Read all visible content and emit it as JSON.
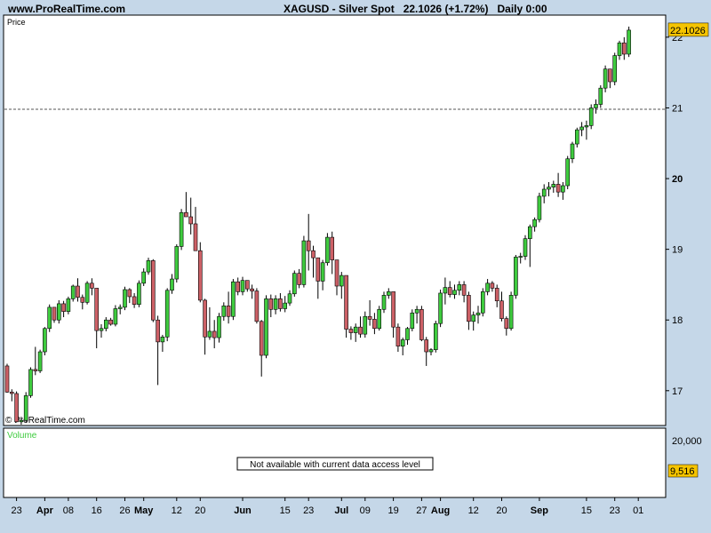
{
  "header": {
    "site": "www.ProRealTime.com",
    "symbol": "XAGUSD - Silver Spot",
    "last": "22.1026",
    "change": "(+1.72%)",
    "timeframe": "Daily",
    "time": "0:00"
  },
  "price_panel": {
    "label": "Price",
    "watermark": "© ProRealTime.com",
    "last_price_tag": "22.1026",
    "reference_line": 20.98
  },
  "volume_panel": {
    "label": "Volume",
    "message": "Not available with current data access level",
    "axis_label": "20,000",
    "value_tag": "9,516"
  },
  "colors": {
    "up": "#3ecb3e",
    "down": "#cc6066",
    "panel_bg": "#ffffff",
    "frame_bg": "#c5d7e8",
    "tag": "#f5c400",
    "volume_label": "#3ecb3e"
  },
  "chart_data": {
    "type": "candlestick",
    "title": "XAGUSD - Silver Spot",
    "ylim": [
      16.52,
      22.3
    ],
    "y_ticks": [
      17,
      18,
      19,
      20,
      21,
      22
    ],
    "x_tick_labels": [
      {
        "label": "23",
        "bar": 2,
        "bold": false
      },
      {
        "label": "Apr",
        "bar": 8,
        "bold": true
      },
      {
        "label": "08",
        "bar": 13,
        "bold": false
      },
      {
        "label": "16",
        "bar": 19,
        "bold": false
      },
      {
        "label": "26",
        "bar": 25,
        "bold": false
      },
      {
        "label": "May",
        "bar": 29,
        "bold": true
      },
      {
        "label": "12",
        "bar": 36,
        "bold": false
      },
      {
        "label": "20",
        "bar": 41,
        "bold": false
      },
      {
        "label": "Jun",
        "bar": 50,
        "bold": true
      },
      {
        "label": "15",
        "bar": 59,
        "bold": false
      },
      {
        "label": "23",
        "bar": 64,
        "bold": false
      },
      {
        "label": "Jul",
        "bar": 71,
        "bold": true
      },
      {
        "label": "09",
        "bar": 76,
        "bold": false
      },
      {
        "label": "19",
        "bar": 82,
        "bold": false
      },
      {
        "label": "27",
        "bar": 88,
        "bold": false
      },
      {
        "label": "Aug",
        "bar": 92,
        "bold": true
      },
      {
        "label": "12",
        "bar": 99,
        "bold": false
      },
      {
        "label": "20",
        "bar": 105,
        "bold": false
      },
      {
        "label": "Sep",
        "bar": 113,
        "bold": true
      },
      {
        "label": "15",
        "bar": 123,
        "bold": false
      },
      {
        "label": "23",
        "bar": 129,
        "bold": false
      },
      {
        "label": "01",
        "bar": 134,
        "bold": false
      }
    ],
    "candles": [
      [
        17.35,
        17.38,
        16.97,
        16.98
      ],
      [
        16.98,
        17.02,
        16.85,
        16.96
      ],
      [
        16.96,
        16.99,
        16.55,
        16.56
      ],
      [
        16.56,
        16.63,
        16.52,
        16.58
      ],
      [
        16.58,
        16.98,
        16.55,
        16.93
      ],
      [
        16.93,
        17.33,
        16.9,
        17.3
      ],
      [
        17.3,
        17.62,
        17.22,
        17.28
      ],
      [
        17.28,
        17.58,
        17.25,
        17.55
      ],
      [
        17.55,
        17.9,
        17.5,
        17.88
      ],
      [
        17.88,
        18.22,
        17.83,
        18.18
      ],
      [
        18.18,
        18.13,
        17.96,
        18.0
      ],
      [
        18.0,
        18.28,
        17.95,
        18.23
      ],
      [
        18.23,
        18.27,
        18.04,
        18.12
      ],
      [
        18.12,
        18.33,
        18.08,
        18.3
      ],
      [
        18.3,
        18.5,
        18.26,
        18.48
      ],
      [
        18.48,
        18.59,
        18.26,
        18.32
      ],
      [
        18.32,
        18.36,
        18.15,
        18.25
      ],
      [
        18.25,
        18.55,
        18.22,
        18.52
      ],
      [
        18.52,
        18.59,
        18.35,
        18.45
      ],
      [
        18.45,
        18.43,
        17.6,
        17.85
      ],
      [
        17.85,
        17.94,
        17.75,
        17.88
      ],
      [
        17.88,
        18.04,
        17.84,
        18.0
      ],
      [
        18.0,
        18.03,
        17.92,
        17.94
      ],
      [
        17.94,
        18.21,
        17.91,
        18.16
      ],
      [
        18.16,
        18.22,
        18.08,
        18.18
      ],
      [
        18.18,
        18.47,
        18.14,
        18.43
      ],
      [
        18.43,
        18.45,
        18.24,
        18.33
      ],
      [
        18.33,
        18.38,
        18.17,
        18.22
      ],
      [
        18.22,
        18.56,
        18.18,
        18.52
      ],
      [
        18.52,
        18.73,
        18.48,
        18.68
      ],
      [
        18.68,
        18.88,
        18.64,
        18.84
      ],
      [
        18.84,
        18.86,
        17.97,
        18.0
      ],
      [
        18.0,
        18.06,
        17.08,
        17.69
      ],
      [
        17.69,
        17.79,
        17.55,
        17.76
      ],
      [
        17.76,
        18.45,
        17.7,
        18.42
      ],
      [
        18.42,
        18.65,
        18.37,
        18.58
      ],
      [
        18.58,
        19.07,
        18.53,
        19.04
      ],
      [
        19.04,
        19.57,
        18.99,
        19.52
      ],
      [
        19.52,
        19.81,
        19.48,
        19.46
      ],
      [
        19.46,
        19.73,
        19.21,
        19.36
      ],
      [
        19.36,
        19.6,
        19.2,
        18.98
      ],
      [
        18.98,
        19.1,
        18.25,
        18.28
      ],
      [
        18.28,
        18.3,
        17.51,
        17.76
      ],
      [
        17.76,
        18.18,
        17.72,
        17.84
      ],
      [
        17.84,
        18.0,
        17.6,
        17.75
      ],
      [
        17.75,
        18.1,
        17.68,
        18.05
      ],
      [
        18.05,
        18.25,
        17.99,
        18.2
      ],
      [
        18.2,
        18.4,
        17.95,
        18.05
      ],
      [
        18.05,
        18.58,
        18.0,
        18.54
      ],
      [
        18.54,
        18.6,
        18.35,
        18.4
      ],
      [
        18.4,
        18.61,
        18.35,
        18.56
      ],
      [
        18.56,
        18.52,
        18.4,
        18.44
      ],
      [
        18.44,
        18.5,
        18.3,
        18.41
      ],
      [
        18.41,
        18.45,
        17.95,
        17.98
      ],
      [
        17.98,
        18.0,
        17.2,
        17.5
      ],
      [
        17.5,
        18.35,
        17.46,
        18.3
      ],
      [
        18.3,
        18.36,
        18.04,
        18.15
      ],
      [
        18.15,
        18.35,
        18.08,
        18.3
      ],
      [
        18.3,
        18.38,
        18.12,
        18.16
      ],
      [
        18.16,
        18.34,
        18.11,
        18.24
      ],
      [
        18.24,
        18.42,
        18.2,
        18.37
      ],
      [
        18.37,
        18.7,
        18.33,
        18.66
      ],
      [
        18.66,
        18.72,
        18.45,
        18.5
      ],
      [
        18.5,
        19.19,
        18.46,
        19.12
      ],
      [
        19.12,
        19.5,
        18.7,
        18.98
      ],
      [
        18.98,
        19.05,
        18.6,
        18.88
      ],
      [
        18.88,
        18.83,
        18.3,
        18.55
      ],
      [
        18.55,
        18.85,
        18.42,
        18.81
      ],
      [
        18.81,
        19.23,
        18.77,
        19.17
      ],
      [
        19.17,
        19.25,
        18.65,
        18.85
      ],
      [
        18.85,
        18.72,
        18.35,
        18.48
      ],
      [
        18.48,
        18.68,
        18.3,
        18.63
      ],
      [
        18.63,
        18.58,
        17.75,
        17.87
      ],
      [
        17.87,
        17.91,
        17.72,
        17.82
      ],
      [
        17.82,
        17.95,
        17.69,
        17.9
      ],
      [
        17.9,
        18.05,
        17.75,
        17.8
      ],
      [
        17.8,
        18.12,
        17.75,
        18.05
      ],
      [
        18.05,
        18.28,
        17.92,
        18.01
      ],
      [
        18.01,
        18.1,
        17.8,
        17.88
      ],
      [
        17.88,
        18.2,
        17.85,
        18.15
      ],
      [
        18.15,
        18.4,
        18.1,
        18.35
      ],
      [
        18.35,
        18.45,
        18.3,
        18.4
      ],
      [
        18.4,
        18.35,
        17.75,
        17.9
      ],
      [
        17.9,
        17.95,
        17.55,
        17.63
      ],
      [
        17.63,
        17.75,
        17.5,
        17.72
      ],
      [
        17.72,
        17.9,
        17.65,
        17.88
      ],
      [
        17.88,
        18.15,
        17.84,
        18.1
      ],
      [
        18.1,
        18.2,
        17.95,
        18.15
      ],
      [
        18.15,
        18.2,
        17.7,
        17.72
      ],
      [
        17.72,
        17.76,
        17.35,
        17.55
      ],
      [
        17.55,
        17.6,
        17.5,
        17.58
      ],
      [
        17.58,
        17.99,
        17.54,
        17.95
      ],
      [
        17.95,
        18.43,
        17.9,
        18.38
      ],
      [
        18.38,
        18.6,
        18.22,
        18.46
      ],
      [
        18.46,
        18.55,
        18.32,
        18.36
      ],
      [
        18.36,
        18.5,
        18.3,
        18.42
      ],
      [
        18.42,
        18.55,
        18.35,
        18.5
      ],
      [
        18.5,
        18.55,
        18.25,
        18.35
      ],
      [
        18.35,
        18.4,
        17.86,
        17.98
      ],
      [
        17.98,
        18.12,
        17.85,
        18.07
      ],
      [
        18.07,
        18.2,
        17.95,
        18.1
      ],
      [
        18.1,
        18.45,
        18.05,
        18.4
      ],
      [
        18.4,
        18.58,
        18.35,
        18.52
      ],
      [
        18.52,
        18.55,
        18.4,
        18.45
      ],
      [
        18.45,
        18.5,
        18.18,
        18.27
      ],
      [
        18.27,
        18.4,
        17.98,
        18.02
      ],
      [
        18.02,
        18.05,
        17.78,
        17.88
      ],
      [
        17.88,
        18.4,
        17.85,
        18.35
      ],
      [
        18.35,
        18.92,
        18.3,
        18.89
      ],
      [
        18.89,
        18.95,
        18.8,
        18.9
      ],
      [
        18.9,
        19.2,
        18.85,
        19.15
      ],
      [
        19.15,
        19.35,
        18.75,
        19.32
      ],
      [
        19.32,
        19.45,
        19.25,
        19.42
      ],
      [
        19.42,
        19.8,
        19.38,
        19.75
      ],
      [
        19.75,
        19.92,
        19.65,
        19.85
      ],
      [
        19.85,
        19.95,
        19.75,
        19.88
      ],
      [
        19.88,
        19.97,
        19.8,
        19.92
      ],
      [
        19.92,
        20.08,
        19.74,
        19.81
      ],
      [
        19.81,
        19.95,
        19.7,
        19.9
      ],
      [
        19.9,
        20.32,
        19.85,
        20.28
      ],
      [
        20.28,
        20.52,
        20.22,
        20.49
      ],
      [
        20.49,
        20.72,
        20.44,
        20.69
      ],
      [
        20.69,
        20.8,
        20.6,
        20.73
      ],
      [
        20.73,
        20.82,
        20.55,
        20.75
      ],
      [
        20.75,
        21.05,
        20.7,
        21.0
      ],
      [
        21.0,
        21.12,
        20.92,
        21.05
      ],
      [
        21.05,
        21.32,
        21.0,
        21.28
      ],
      [
        21.28,
        21.6,
        21.22,
        21.55
      ],
      [
        21.55,
        21.5,
        21.28,
        21.37
      ],
      [
        21.37,
        21.78,
        21.32,
        21.74
      ],
      [
        21.74,
        21.95,
        21.68,
        21.92
      ],
      [
        21.92,
        22.0,
        21.68,
        21.76
      ],
      [
        21.76,
        22.15,
        21.72,
        22.1
      ]
    ]
  }
}
